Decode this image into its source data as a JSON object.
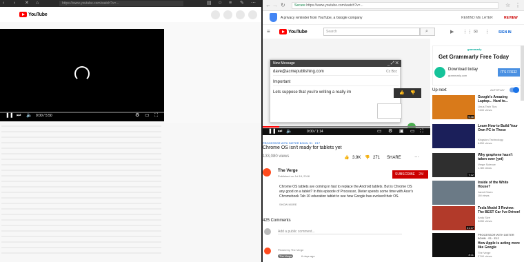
{
  "left_window": {
    "url": "https://www.youtube.com/watch?v=...",
    "logo_text": "YouTube",
    "player": {
      "time": "0:00 / 5:50"
    }
  },
  "right_window": {
    "url_secure": "Secure",
    "url": "https://www.youtube.com/watch?v=...",
    "reminder": {
      "text": "A privacy reminder from YouTube, a Google company",
      "remind_later": "REMIND ME LATER",
      "review": "REVIEW"
    },
    "header": {
      "logo_text": "YouTube",
      "search_placeholder": "Search",
      "sign_in": "SIGN IN"
    },
    "gmail": {
      "title": "New Message",
      "to": "dave@acmepublishing.com",
      "cc_bcc": "Cc Bcc",
      "subject": "Important",
      "body": "Lets suppose that you're writing a really im"
    },
    "player": {
      "time": "0:00 / 1:14",
      "progress": 0.1
    },
    "video": {
      "hashtag": "PROCESSOR WITH DIETER BOHN: S1 · E17",
      "title": "Chrome OS isn't ready for tablets yet",
      "views": "133,080 views",
      "likes": "3.9K",
      "dislikes": "271",
      "share": "SHARE"
    },
    "channel": {
      "name": "The Verge",
      "published": "Published on Jul 18, 2018",
      "subscribe": "SUBSCRIBE",
      "subs": "2M"
    },
    "description": "Chrome OS tablets are coming in fast to replace the Android tablets. But is Chrome OS any good on a tablet? In this episode of Processor, Dieter spends some time with Acer's Chromebook Tab 10 education tablet to see how Google has evolved their OS.",
    "show_more": "SHOW MORE",
    "comments": {
      "count": "425 Comments",
      "placeholder": "Add a public comment...",
      "pinned": "Pinned by The Verge",
      "author": "The Verge",
      "age": "6 days ago"
    },
    "ad": {
      "brand": "grammarly",
      "headline": "Get Grammarly Free Today",
      "download": "Download today",
      "site": "grammarly.com",
      "cta": "IT'S FREE!"
    },
    "up_next": {
      "label": "Up next",
      "autoplay": "AUTOPLAY",
      "items": [
        {
          "title": "Google's Amazing Laptop... Hard to...",
          "channel": "Linus Tech Tips",
          "views": "744K views",
          "duration": "9:48",
          "color": "#d97a1a"
        },
        {
          "title": "Learn How to Build Your Own PC in These",
          "channel": "Kingston Technology",
          "views": "645K views",
          "duration": "",
          "color": "#1b1f5a"
        },
        {
          "title": "Why graphene hasn't taken over (yet)",
          "channel": "Verge Science",
          "views": "1.3M views",
          "duration": "7:12",
          "color": "#2f2f2f"
        },
        {
          "title": "Inside of the White House?",
          "channel": "Jared Owen",
          "views": "1M views",
          "duration": "",
          "color": "#6b7a86"
        },
        {
          "title": "Tesla Model 3 Review: The BEST Car I've Driven!",
          "channel": "Andy Size",
          "views": "328K views",
          "duration": "21:17",
          "color": "#b23a2a"
        },
        {
          "title": "How Apple is acting more like Google",
          "channel": "The Verge",
          "views": "374K views",
          "duration": "8:11",
          "color": "#111111"
        }
      ],
      "processor_label": "PROCESSOR WITH DIETER BOHN · S1 · E12"
    }
  }
}
